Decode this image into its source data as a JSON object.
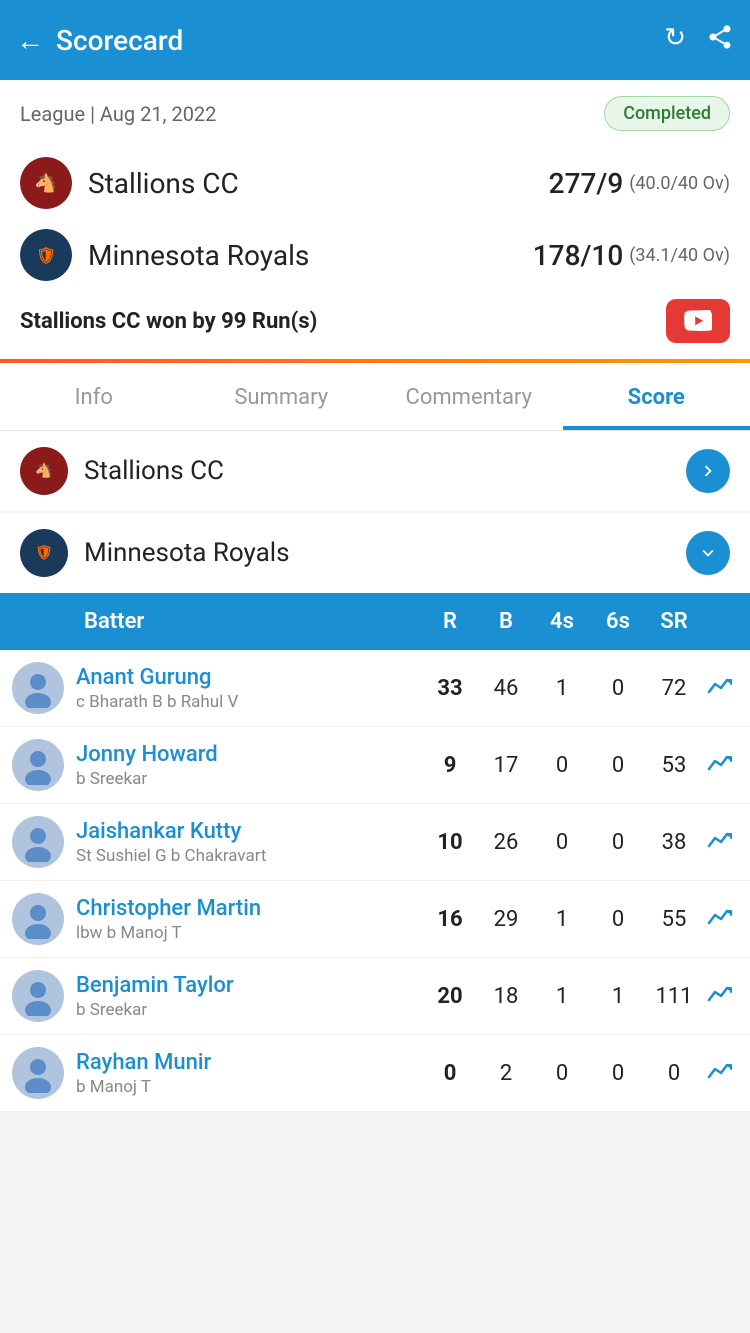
{
  "header": {
    "title": "Scorecard",
    "back_icon": "←",
    "refresh_icon": "↻",
    "share_icon": "➤"
  },
  "match": {
    "meta": "League | Aug 21, 2022",
    "status": "Completed",
    "team1": {
      "name": "Stallions CC",
      "score": "277/9",
      "overs": "(40.0/40 Ov)"
    },
    "team2": {
      "name": "Minnesota Royals",
      "score": "178/10",
      "overs": "(34.1/40 Ov)"
    },
    "result": "Stallions CC won by 99 Run(s)"
  },
  "tabs": [
    {
      "id": "info",
      "label": "Info"
    },
    {
      "id": "summary",
      "label": "Summary"
    },
    {
      "id": "commentary",
      "label": "Commentary"
    },
    {
      "id": "score",
      "label": "Score",
      "active": true
    }
  ],
  "scorecard": {
    "team1": {
      "name": "Stallions CC",
      "expanded": false
    },
    "team2": {
      "name": "Minnesota Royals",
      "expanded": true
    },
    "table_headers": {
      "batter": "Batter",
      "r": "R",
      "b": "B",
      "fours": "4s",
      "sixes": "6s",
      "sr": "SR"
    },
    "batters": [
      {
        "name": "Anant Gurung",
        "dismissal": "c Bharath B b Rahul V",
        "r": "33",
        "b": "46",
        "fours": "1",
        "sixes": "0",
        "sr": "72"
      },
      {
        "name": "Jonny Howard",
        "dismissal": "b Sreekar",
        "r": "9",
        "b": "17",
        "fours": "0",
        "sixes": "0",
        "sr": "53"
      },
      {
        "name": "Jaishankar Kutty",
        "dismissal": "St Sushiel G b Chakravart",
        "r": "10",
        "b": "26",
        "fours": "0",
        "sixes": "0",
        "sr": "38"
      },
      {
        "name": "Christopher Martin",
        "dismissal": "lbw b Manoj T",
        "r": "16",
        "b": "29",
        "fours": "1",
        "sixes": "0",
        "sr": "55"
      },
      {
        "name": "Benjamin Taylor",
        "dismissal": "b Sreekar",
        "r": "20",
        "b": "18",
        "fours": "1",
        "sixes": "1",
        "sr": "111"
      },
      {
        "name": "Rayhan Munir",
        "dismissal": "b Manoj T",
        "r": "0",
        "b": "2",
        "fours": "0",
        "sixes": "0",
        "sr": "0"
      }
    ]
  }
}
